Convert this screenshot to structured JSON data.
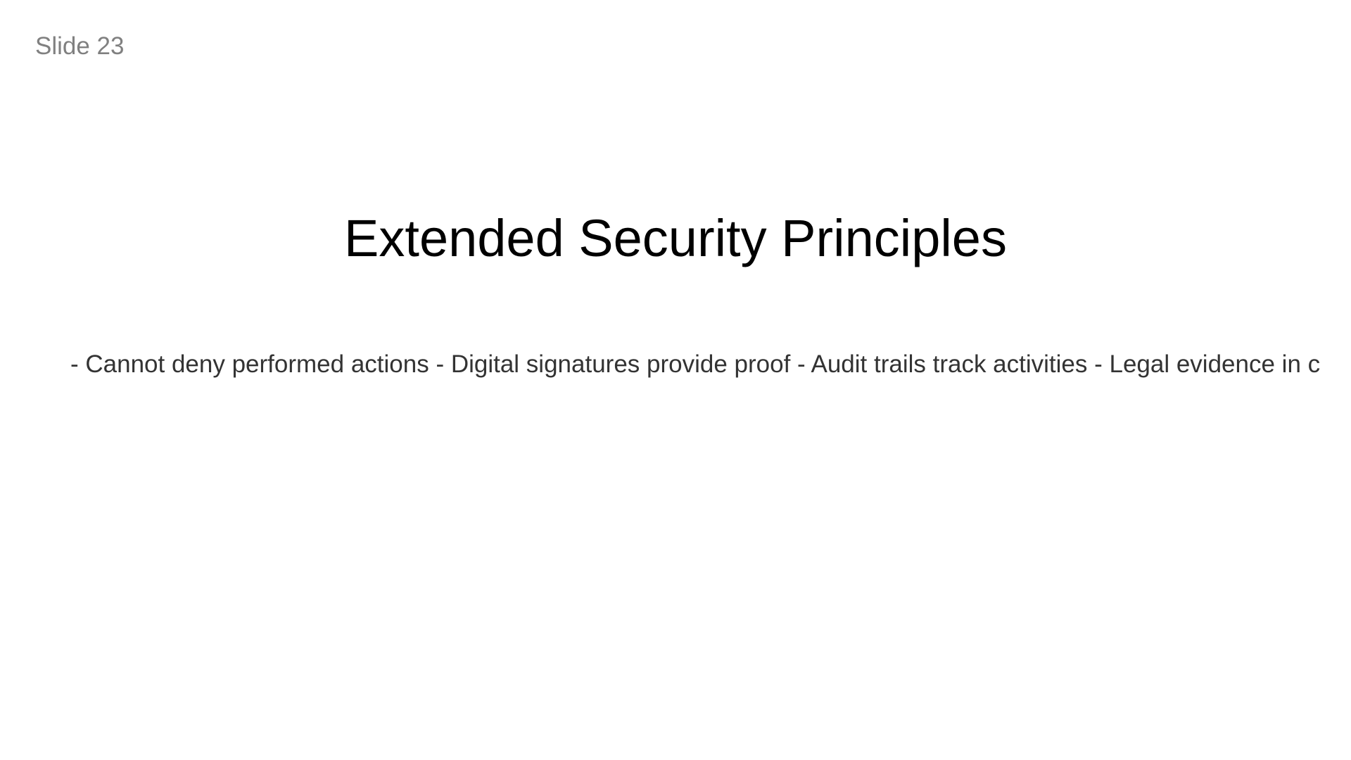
{
  "slide": {
    "number_label": "Slide 23",
    "title": "Extended Security Principles",
    "body": "- Cannot deny performed actions - Digital signatures provide proof - Audit trails track activities - Legal evidence in c"
  },
  "colors": {
    "background": "#ffffff",
    "title": "#000000",
    "body": "#333333",
    "slide_number": "#808080"
  }
}
